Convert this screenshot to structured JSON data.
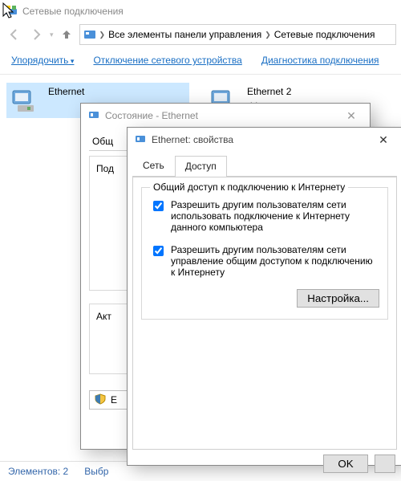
{
  "window": {
    "title": "Сетевые подключения"
  },
  "breadcrumb": {
    "seg1": "Все элементы панели управления",
    "seg2": "Сетевые подключения"
  },
  "toolbar": {
    "organize": "Упорядочить",
    "disable": "Отключение сетевого устройства",
    "diagnose": "Диагностика подключения"
  },
  "connections": {
    "a": {
      "name": "Ethernet"
    },
    "b": {
      "name": "Ethernet 2",
      "extra": "d Internet"
    }
  },
  "statusDlg": {
    "title": "Состояние - Ethernet",
    "tab_general": "Общ",
    "lbl_conn": "Под",
    "lbl_act": "Акт",
    "lbl_e": "E"
  },
  "propsDlg": {
    "title": "Ethernet: свойства",
    "tab_network": "Сеть",
    "tab_sharing": "Доступ",
    "group_title": "Общий доступ к подключению к Интернету",
    "chk1": "Разрешить другим пользователям сети использовать подключение к Интернету данного компьютера",
    "chk2": "Разрешить другим пользователям сети управление общим доступом к подключению к Интернету",
    "settings_btn": "Настройка..."
  },
  "statusbar": {
    "count": "Элементов: 2",
    "selected": "Выбр"
  },
  "footerBtn": {
    "ok": "OK"
  }
}
